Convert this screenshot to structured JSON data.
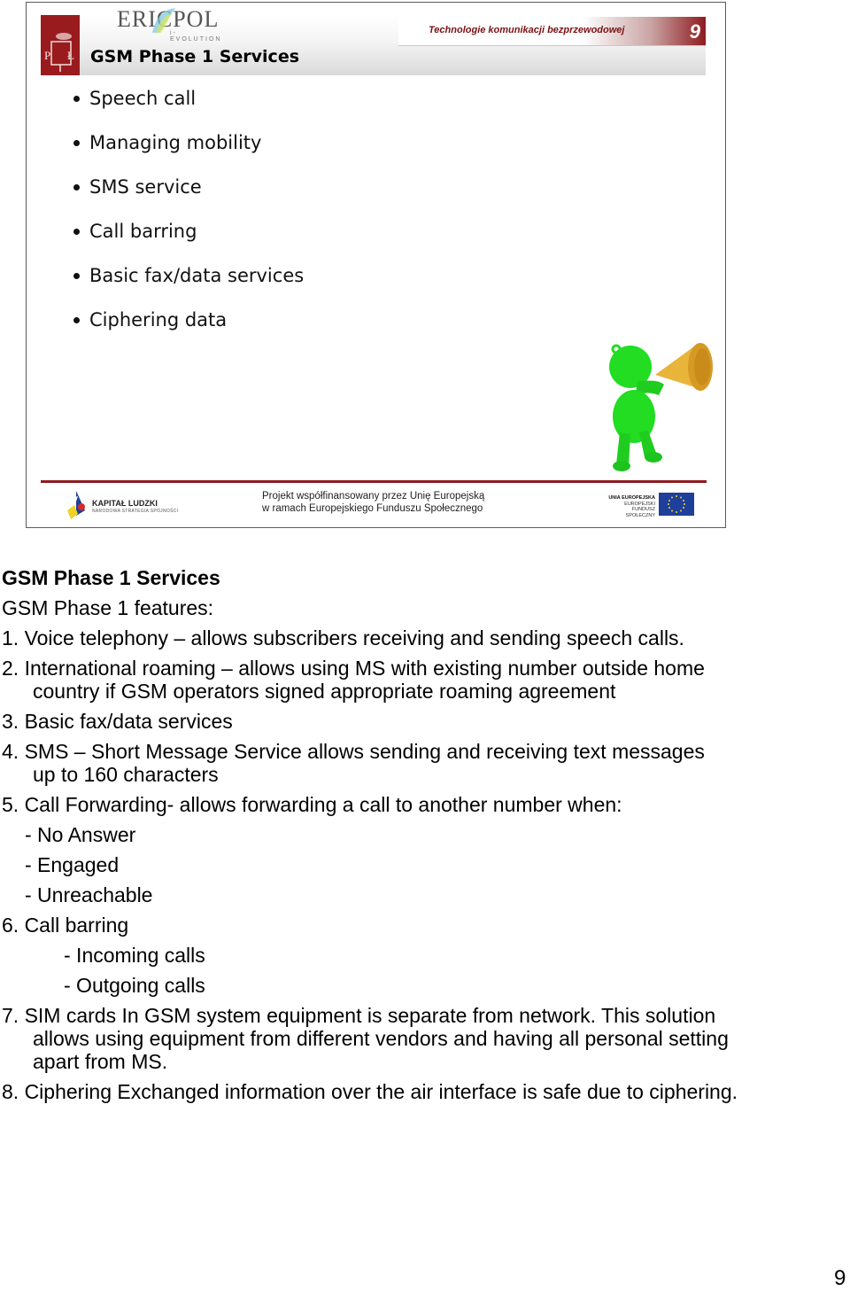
{
  "slide": {
    "logo_text": "ERICPOL",
    "logo_sub": "i-EVOLUTION",
    "title": "GSM Phase 1 Services",
    "course_name": "Technologie komunikacji bezprzewodowej",
    "slide_number": "9",
    "bullets": [
      "Speech call",
      "Managing mobility",
      "SMS service",
      "Call barring",
      "Basic fax/data services",
      "Ciphering data"
    ],
    "footer": {
      "kl_title": "KAPITAŁ LUDZKI",
      "kl_subtitle": "NARODOWA STRATEGIA SPÓJNOŚCI",
      "funding_line1": "Projekt współfinansowany przez Unię Europejską",
      "funding_line2": "w ramach Europejskiego Funduszu Społecznego",
      "ue_line1": "UNIA EUROPEJSKA",
      "ue_line2": "EUROPEJSKI",
      "ue_line3": "FUNDUSZ SPOŁECZNY"
    },
    "colors": {
      "accent": "#8e1b1e",
      "mascot": "#22dd22",
      "megaphone": "#e8b53a"
    }
  },
  "notes": {
    "title": "GSM Phase 1 Services",
    "intro": "GSM Phase 1 features:",
    "lines": [
      "1.  Voice telephony – allows subscribers receiving and sending speech calls.",
      "2.   International roaming – allows using MS with existing number outside home",
      "country if GSM operators signed appropriate roaming agreement",
      "3.   Basic fax/data services",
      "4.  SMS – Short Message Service allows sending and receiving text messages",
      "up to 160 characters",
      "5. Call Forwarding- allows forwarding a call to another number when:",
      "- No Answer",
      "- Engaged",
      "- Unreachable",
      "6. Call barring",
      "- Incoming calls",
      "- Outgoing calls",
      "7. SIM cards In GSM system equipment is separate from network. This solution",
      "allows using equipment from different vendors and having all personal setting",
      "apart from MS.",
      "8. Ciphering Exchanged information over the air interface is safe due to ciphering."
    ]
  },
  "page_number": "9"
}
